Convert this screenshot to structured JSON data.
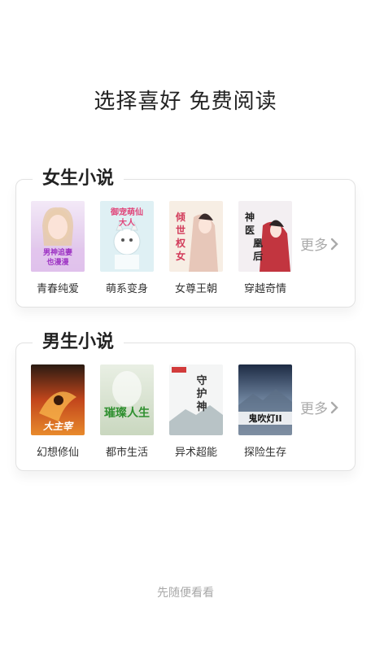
{
  "title": "选择喜好 免费阅读",
  "female": {
    "heading": "女生小说",
    "books": [
      {
        "label": "青春纯爱",
        "cover_text": "男神追妻也漫漫",
        "icon": "romance-cover"
      },
      {
        "label": "萌系变身",
        "cover_text": "御宠萌仙大人",
        "icon": "cute-cover"
      },
      {
        "label": "女尊王朝",
        "cover_text": "倾世权女",
        "icon": "empress-cover"
      },
      {
        "label": "穿越奇情",
        "cover_text": "神医凰后",
        "icon": "timetravel-cover"
      }
    ],
    "more": "更多"
  },
  "male": {
    "heading": "男生小说",
    "books": [
      {
        "label": "幻想修仙",
        "cover_text": "大主宰",
        "icon": "fantasy-cover"
      },
      {
        "label": "都市生活",
        "cover_text": "璀璨人生",
        "icon": "city-cover"
      },
      {
        "label": "异术超能",
        "cover_text": "守护神",
        "icon": "supernatural-cover"
      },
      {
        "label": "探险生存",
        "cover_text": "鬼吹灯II",
        "icon": "adventure-cover"
      }
    ],
    "more": "更多"
  },
  "skip": "先随便看看",
  "colors": {
    "title": "#222222",
    "more": "#aaaaaa",
    "skip": "#a8a8a8",
    "border": "#e2e2e2"
  }
}
